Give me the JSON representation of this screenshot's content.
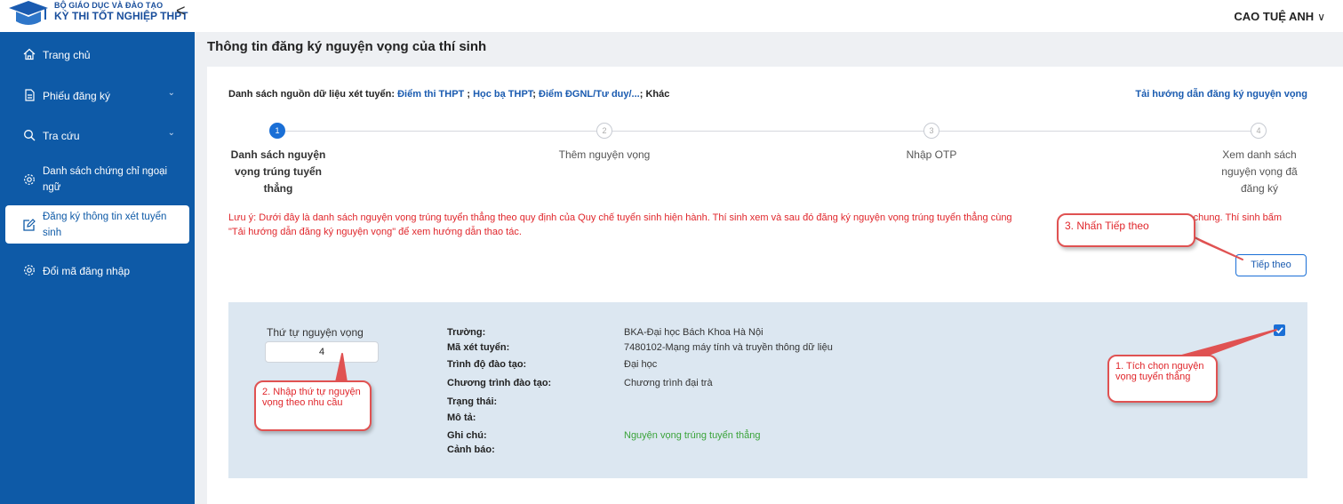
{
  "header": {
    "logo_line1": "BỘ GIÁO DỤC VÀ ĐÀO TẠO",
    "logo_line2": "KỲ THI TỐT NGHIỆP THPT",
    "collapse_glyph": "<",
    "user_name": "CAO TUỆ ANH",
    "user_chevron": "∨"
  },
  "sidebar": {
    "items": [
      {
        "label": "Trang chủ",
        "icon": "home-icon"
      },
      {
        "label": "Phiếu đăng ký",
        "icon": "document-icon",
        "has_dropdown": true
      },
      {
        "label": "Tra cứu",
        "icon": "search-icon",
        "has_dropdown": true
      },
      {
        "label_line1": "Danh sách chứng chỉ ngoại",
        "label_line2": "ngữ",
        "icon": "gear-icon"
      },
      {
        "label_line1": "Đăng ký thông tin xét tuyển",
        "label_line2": "sinh",
        "icon": "edit-icon",
        "active": true
      },
      {
        "label": "Đổi mã đăng nhập",
        "icon": "gear-icon"
      }
    ],
    "dropdown_glyph": "⌄"
  },
  "page": {
    "title": "Thông tin đăng ký nguyện vọng của thí sinh",
    "sources_prefix": "Danh sách nguồn dữ liệu xét tuyển:",
    "source_1": "Điểm thi THPT",
    "sep_1": " ; ",
    "source_2": "Học bạ THPT",
    "sep_2": "; ",
    "source_3": "Điểm ĐGNL/Tư duy/...",
    "source_suffix": "; Khác",
    "guide_link": "Tải hướng dẫn đăng ký nguyện vọng"
  },
  "steps": [
    {
      "num": "1",
      "line1": "Danh sách nguyện",
      "line2": "vọng trúng tuyển",
      "line3": "thẳng",
      "status": "current"
    },
    {
      "num": "2",
      "line1": "Thêm nguyện vọng",
      "status": "pending"
    },
    {
      "num": "3",
      "line1": "Nhập OTP",
      "status": "pending"
    },
    {
      "num": "4",
      "line1": "Xem danh sách",
      "line2": "nguyện vọng đã",
      "line3": "đăng ký",
      "status": "pending"
    }
  ],
  "note": {
    "line1": "Lưu ý: Dưới đây là danh sách nguyện vọng trúng tuyển thẳng theo quy định của Quy chế tuyển sinh hiện hành. Thí sinh xem và sau đó đăng ký nguyện vọng trúng tuyển thẳng cùng",
    "line1_end": "theo lịch chung. Thí sinh bấm",
    "line2": "\"Tải hướng dẫn đăng ký nguyện vọng\" để xem hướng dẫn thao tác."
  },
  "next_button": "Tiếp theo",
  "application": {
    "order_label": "Thứ tự nguyện vọng",
    "order_value": "4",
    "fields": [
      {
        "label": "Trường:",
        "value": "BKA-Đại học Bách Khoa Hà Nội"
      },
      {
        "label": "Mã xét tuyển:",
        "value": "7480102-Mạng máy tính và truyền thông dữ liệu"
      },
      {
        "label": "Trình độ đào tạo:",
        "value": "Đại học"
      },
      {
        "label": "Chương trình đào tạo:",
        "value": "Chương trình đại trà"
      },
      {
        "label": "Trạng thái:",
        "value": ""
      },
      {
        "label": "Mô tả:",
        "value": ""
      },
      {
        "label": "Ghi chú:",
        "value": "Nguyện vọng trúng tuyển thẳng"
      },
      {
        "label": "Cảnh báo:",
        "value": ""
      }
    ],
    "checked": true,
    "check_glyph": "✓",
    "note_color": "#3aa33a"
  },
  "callouts": {
    "c1": "1. Tích chọn nguyện vọng tuyển thẳng",
    "c2": "2. Nhập thứ tự nguyện vọng theo nhu cầu",
    "c3": "3. Nhấn Tiếp theo"
  },
  "colors": {
    "sidebar": "#0e5aa7",
    "accent": "#1a6fd6",
    "warning": "#e0262b"
  }
}
